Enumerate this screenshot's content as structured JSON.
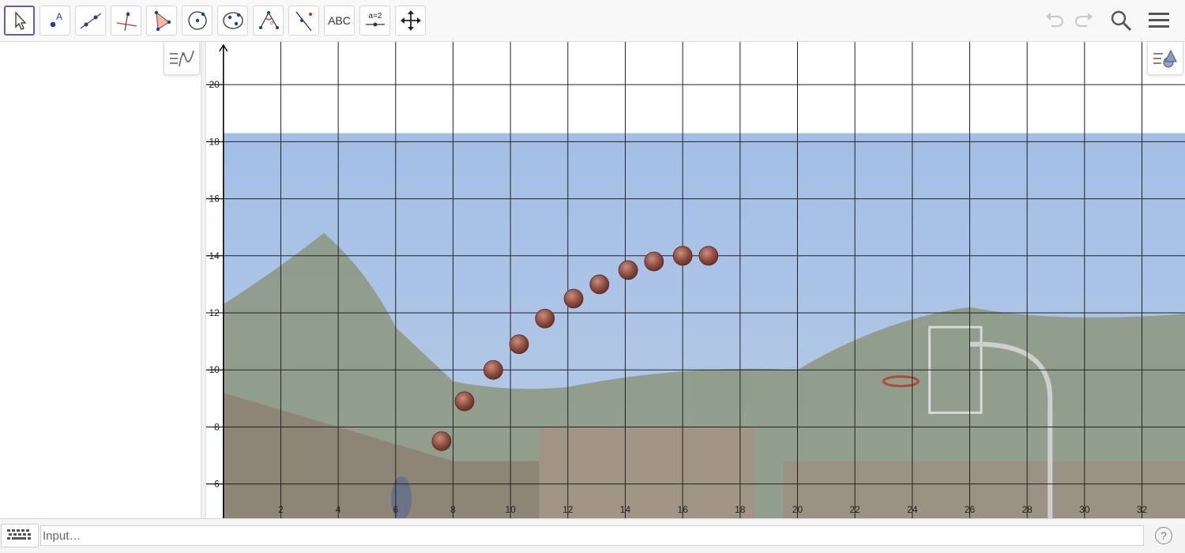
{
  "toolbar": {
    "tools": [
      {
        "name": "move-tool",
        "icon": "arrow-pointer-icon"
      },
      {
        "name": "point-tool",
        "icon": "point-icon"
      },
      {
        "name": "line-tool",
        "icon": "line-through-points-icon"
      },
      {
        "name": "perpendicular-line-tool",
        "icon": "perpendicular-line-icon"
      },
      {
        "name": "polygon-tool",
        "icon": "polygon-icon"
      },
      {
        "name": "circle-tool",
        "icon": "circle-center-point-icon"
      },
      {
        "name": "ellipse-tool",
        "icon": "ellipse-icon"
      },
      {
        "name": "angle-tool",
        "icon": "angle-icon"
      },
      {
        "name": "reflect-tool",
        "icon": "reflect-about-line-icon"
      },
      {
        "name": "text-tool",
        "label": "ABC"
      },
      {
        "name": "slider-tool",
        "label": "a=2"
      },
      {
        "name": "move-graphics-tool",
        "icon": "move-graphics-icon"
      }
    ],
    "right_icons": [
      "undo-icon",
      "redo-icon",
      "search-icon",
      "menu-icon"
    ]
  },
  "graphics": {
    "x_ticks": [
      "2",
      "4",
      "6",
      "8",
      "10",
      "12",
      "14",
      "16",
      "18",
      "20",
      "22",
      "24",
      "26",
      "28",
      "30",
      "32"
    ],
    "y_ticks": [
      "20",
      "18",
      "16",
      "14",
      "12",
      "10",
      "8",
      "6"
    ],
    "x_range": [
      -0.6,
      33.5
    ],
    "y_range": [
      4.8,
      21.5
    ],
    "background_image": {
      "description_icon": "basketball-shot-photo",
      "top_y": 18.3,
      "sky_color": "#a2bde5",
      "ball_positions": [
        {
          "x": 7.6,
          "y": 7.5
        },
        {
          "x": 8.4,
          "y": 8.9
        },
        {
          "x": 9.4,
          "y": 10.0
        },
        {
          "x": 10.3,
          "y": 10.9
        },
        {
          "x": 11.2,
          "y": 11.8
        },
        {
          "x": 12.2,
          "y": 12.5
        },
        {
          "x": 13.1,
          "y": 13.0
        },
        {
          "x": 14.1,
          "y": 13.5
        },
        {
          "x": 15.0,
          "y": 13.8
        },
        {
          "x": 16.0,
          "y": 14.0
        },
        {
          "x": 16.9,
          "y": 14.0
        }
      ]
    }
  },
  "input_bar": {
    "placeholder": "Input…",
    "help_label": "?"
  }
}
